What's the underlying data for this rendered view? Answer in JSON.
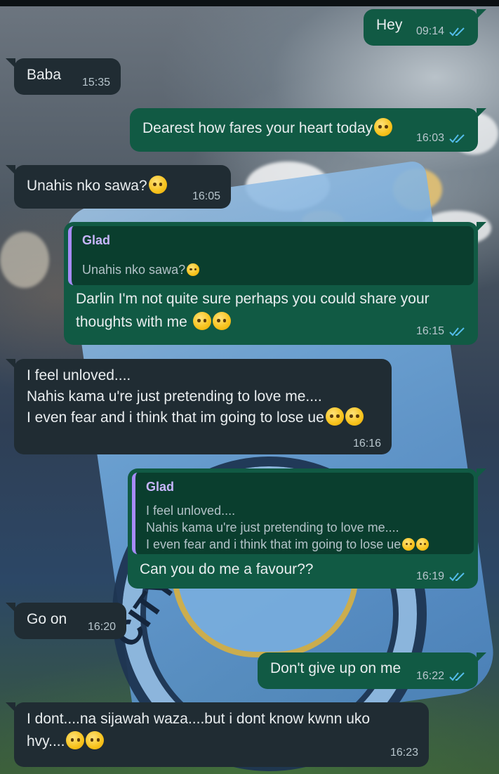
{
  "colors": {
    "outgoing_bubble": "#115a44",
    "incoming_bubble": "#202c33",
    "quote_bar": "#a78bfa",
    "read_ticks": "#53bdeb"
  },
  "wallpaper": {
    "description_icon": "manchester-city-flag-wallpaper"
  },
  "messages": [
    {
      "dir": "out",
      "text": "Hey",
      "time": "09:14",
      "status": "read"
    },
    {
      "dir": "in",
      "text": "Baba",
      "time": "15:35"
    },
    {
      "dir": "out",
      "text": "Dearest how fares your heart today",
      "emoji": [
        "smiling-face"
      ],
      "time": "16:03",
      "status": "read"
    },
    {
      "dir": "in",
      "text": "Unahis nko sawa?",
      "emoji": [
        "pleading-face"
      ],
      "time": "16:05"
    },
    {
      "dir": "out",
      "quote": {
        "author": "Glad",
        "lines": [
          "Unahis nko sawa?"
        ]
      },
      "lines": [
        "Darlin I'm not quite sure perhaps you could share your",
        "thoughts with me"
      ],
      "emoji": [
        "face-holding-back-tears",
        "face-holding-back-tears"
      ],
      "time": "16:15",
      "status": "read"
    },
    {
      "dir": "in",
      "lines": [
        "I feel unloved....",
        "Nahis kama u're just pretending to love me....",
        "I even fear and i think that im going to lose ue"
      ],
      "emoji": [
        "pleading-face",
        "weary-face"
      ],
      "time": "16:16"
    },
    {
      "dir": "out",
      "quote": {
        "author": "Glad",
        "lines": [
          "I feel unloved....",
          "Nahis kama u're just pretending to love me....",
          "I even fear and i think that im going to lose ue"
        ]
      },
      "text": "Can you do me a favour??",
      "time": "16:19",
      "status": "read"
    },
    {
      "dir": "in",
      "text": "Go on",
      "time": "16:20"
    },
    {
      "dir": "out",
      "text": "Don't give up on me",
      "time": "16:22",
      "status": "read"
    },
    {
      "dir": "in",
      "lines": [
        "I dont....na sijawah waza....but i dont know kwnn uko",
        "hvy...."
      ],
      "emoji": [
        "pleading-face",
        "weary-face"
      ],
      "time": "16:23"
    }
  ]
}
